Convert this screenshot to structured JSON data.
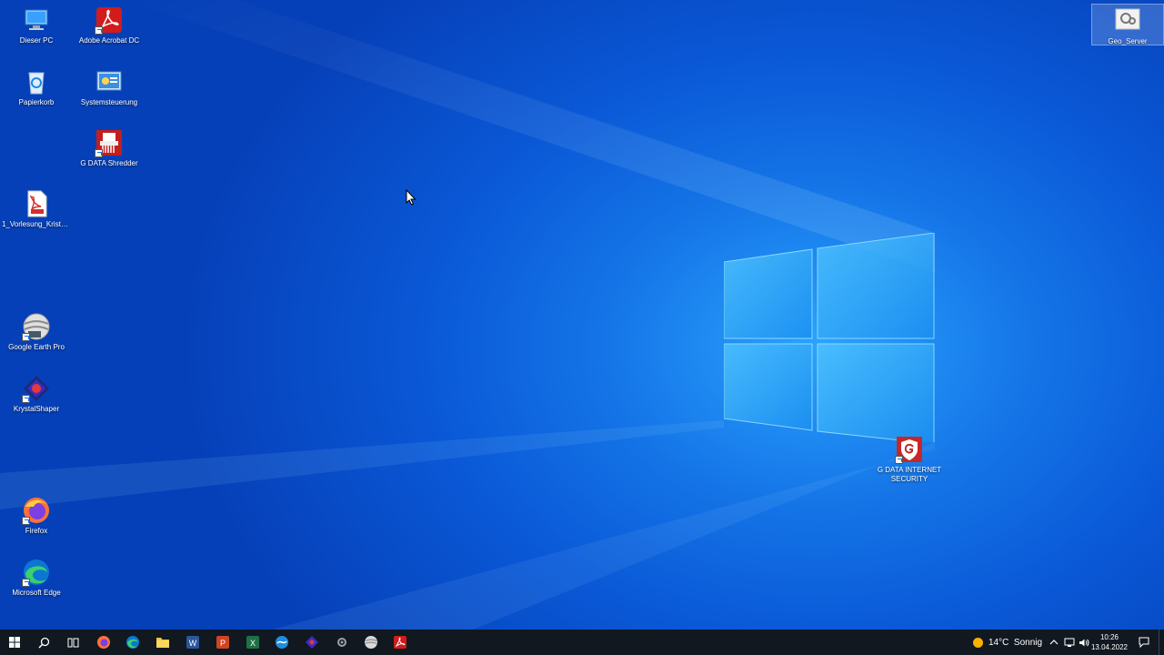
{
  "desktop": {
    "icons": [
      {
        "name": "this-pc",
        "label": "Dieser PC"
      },
      {
        "name": "adobe-acrobat-dc",
        "label": "Adobe Acrobat DC"
      },
      {
        "name": "recycle-bin",
        "label": "Papierkorb"
      },
      {
        "name": "control-panel",
        "label": "Systemsteuerung"
      },
      {
        "name": "gdata-shredder",
        "label": "G DATA Shredder"
      },
      {
        "name": "pdf-file",
        "label": "1_Vorlesung_Kristal..."
      },
      {
        "name": "google-earth-pro",
        "label": "Google Earth Pro"
      },
      {
        "name": "krystalshaper",
        "label": "KrystalShaper"
      },
      {
        "name": "firefox",
        "label": "Firefox"
      },
      {
        "name": "microsoft-edge",
        "label": "Microsoft Edge"
      },
      {
        "name": "geo-server",
        "label": "Geo_Server"
      },
      {
        "name": "gdata-internet-security",
        "label": "G DATA INTERNET SECURITY"
      }
    ]
  },
  "taskbar": {
    "weather": {
      "text": "14°C  Sonnig"
    },
    "clock": {
      "time": "10:26",
      "date": "13.04.2022"
    }
  },
  "colors": {
    "accent": "#1473e6",
    "taskbar": "#111820"
  }
}
